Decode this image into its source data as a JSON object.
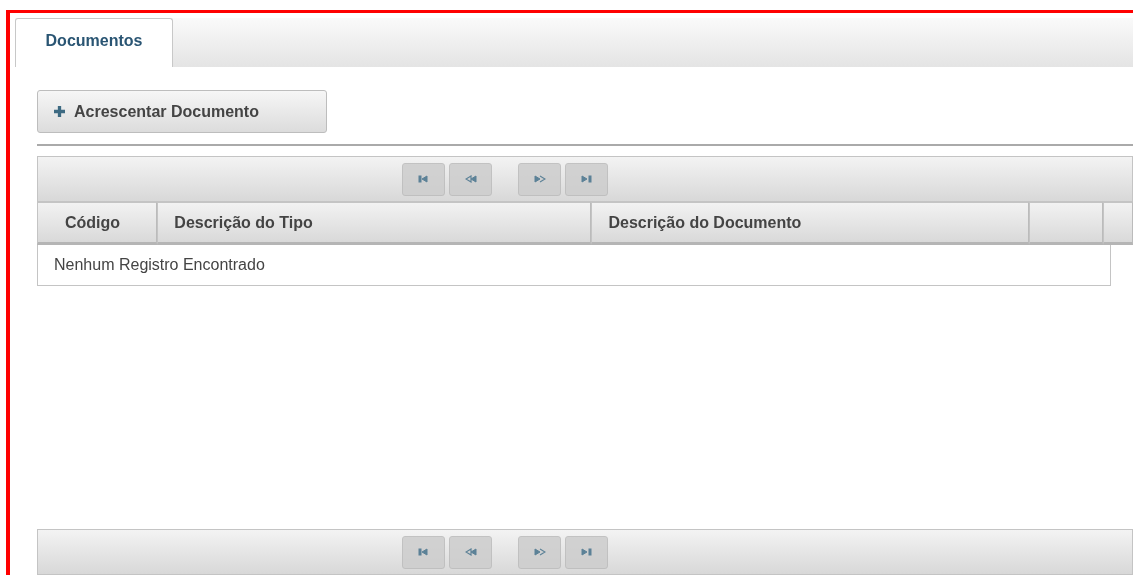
{
  "tabs": [
    {
      "label": "Documentos",
      "selected": true
    }
  ],
  "add_button": {
    "label": "Acrescentar Documento"
  },
  "paginator_top": {
    "buttons": [
      {
        "kind": "first",
        "disabled": true
      },
      {
        "kind": "prev",
        "disabled": true
      },
      {
        "kind": "next",
        "disabled": true
      },
      {
        "kind": "last",
        "disabled": true
      }
    ]
  },
  "table": {
    "columns": [
      {
        "label": "Código"
      },
      {
        "label": "Descrição do Tipo"
      },
      {
        "label": "Descrição do Documento"
      }
    ],
    "empty_message": "Nenhum Registro Encontrado"
  },
  "paginator_bottom": {
    "buttons": [
      {
        "kind": "first",
        "disabled": true
      },
      {
        "kind": "prev",
        "disabled": true
      },
      {
        "kind": "next",
        "disabled": true
      },
      {
        "kind": "last",
        "disabled": true
      }
    ]
  }
}
